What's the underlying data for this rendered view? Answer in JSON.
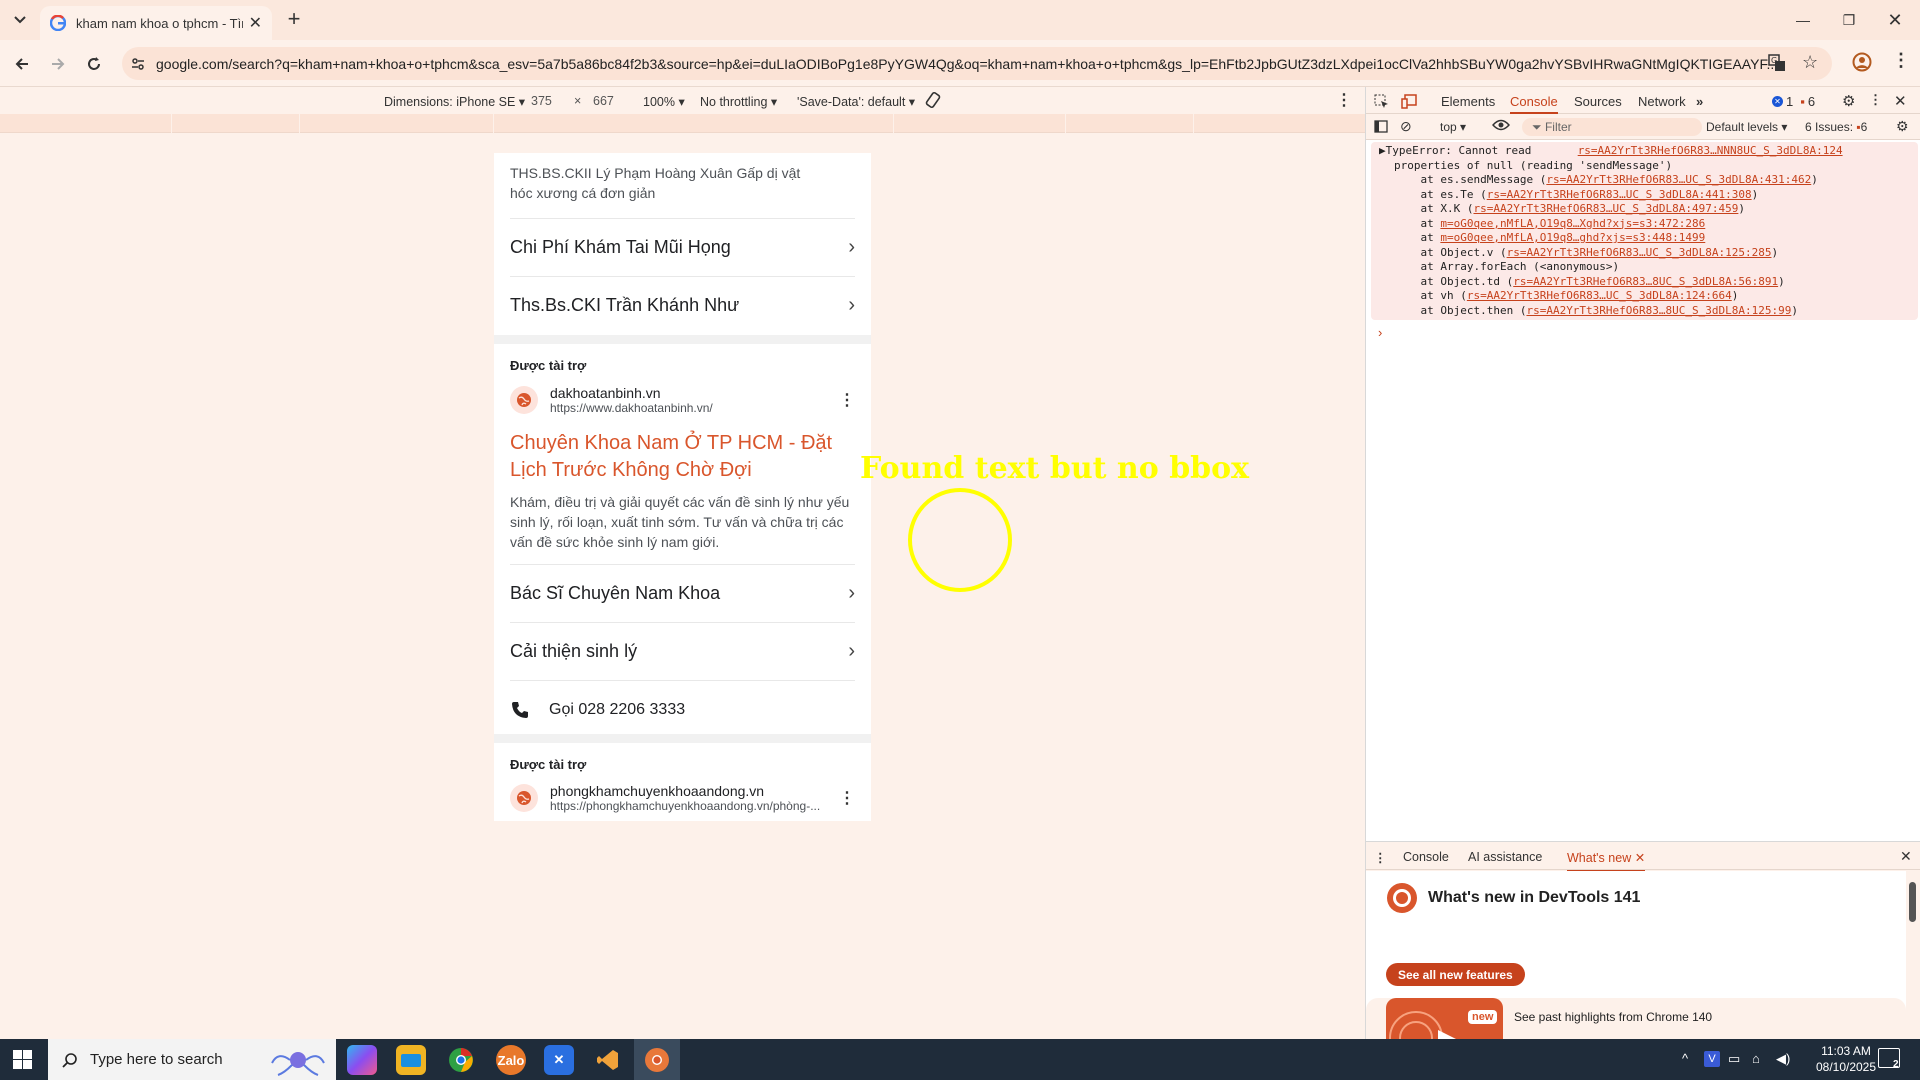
{
  "browser": {
    "tab_title": "kham nam khoa o tphcm - Tìm",
    "url": "google.com/search?q=kham+nam+khoa+o+tphcm&sca_esv=5a7b5a86bc84f2b3&source=hp&ei=duLIaODIBoPg1e8PyYGW4Qg&oq=kham+nam+khoa+o+tphcm&gs_lp=EhFtb2JpbGUtZ3dzLXdpei1ocClVa2hhbSBuYW0ga2hvYSBvIHRwaGNtMgIQKTIGEAAYF..."
  },
  "device_toolbar": {
    "dimensions": "Dimensions: iPhone SE",
    "width": "375",
    "times": "×",
    "height": "667",
    "zoom": "100%",
    "throttling": "No throttling",
    "save_data": "'Save-Data': default"
  },
  "page": {
    "top_snippet": "THS.BS.CKII Lý Phạm Hoàng Xuân Gấp dị vật hóc xương cá đơn giản",
    "links1": [
      "Chi Phí Khám Tai Mũi Họng",
      "Ths.Bs.CKI Trần Khánh Như"
    ],
    "ad1": {
      "sponsored": "Được tài trợ",
      "site_name": "dakhoatanbinh.vn",
      "site_url": "https://www.dakhoatanbinh.vn/",
      "title": "Chuyên Khoa Nam Ở TP HCM - Đặt Lịch Trước Không Chờ Đợi",
      "description": "Khám, điều trị và giải quyết các vấn đề sinh lý như yếu sinh lý, rối loạn, xuất tinh sớm. Tư vấn và chữa trị các vấn đề sức khỏe sinh lý nam giới.",
      "links": [
        "Bác Sĩ Chuyên Nam Khoa",
        "Cải thiện sinh lý"
      ],
      "call": "Gọi 028 2206 3333"
    },
    "ad2": {
      "sponsored": "Được tài trợ",
      "site_name": "phongkhamchuyenkhoaandong.vn",
      "site_url": "https://phongkhamchuyenkhoaandong.vn/phòng-..."
    }
  },
  "overlay": {
    "label": "Found text but no bbox",
    "color": "#ffff00"
  },
  "devtools": {
    "tabs": [
      "Elements",
      "Console",
      "Sources",
      "Network"
    ],
    "active_tab": "Console",
    "error_count": "1",
    "warning_count": "6",
    "context": "top",
    "filter_placeholder": "Filter",
    "levels": "Default levels",
    "issues": "6 Issues:",
    "issues_count": "6",
    "console_lines": [
      {
        "text": "▶TypeError: Cannot read       ",
        "link": "rs=AA2YrTt3RHefO6R83…NNN8UC_S_3dDL8A:124"
      },
      {
        "text": "properties of null (reading 'sendMessage')",
        "link": ""
      },
      {
        "text": "    at es.sendMessage (",
        "link": "rs=AA2YrTt3RHefO6R83…UC_S_3dDL8A:431:462",
        "tail": ")"
      },
      {
        "text": "    at es.Te (",
        "link": "rs=AA2YrTt3RHefO6R83…UC_S_3dDL8A:441:308",
        "tail": ")"
      },
      {
        "text": "    at X.K (",
        "link": "rs=AA2YrTt3RHefO6R83…UC_S_3dDL8A:497:459",
        "tail": ")"
      },
      {
        "text": "    at ",
        "link": "m=oG0qee,nMfLA,O19q8…Xghd?xjs=s3:472:286",
        "tail": ""
      },
      {
        "text": "    at ",
        "link": "m=oG0qee,nMfLA,O19q8…ghd?xjs=s3:448:1499",
        "tail": ""
      },
      {
        "text": "    at Object.v (",
        "link": "rs=AA2YrTt3RHefO6R83…UC_S_3dDL8A:125:285",
        "tail": ")"
      },
      {
        "text": "    at Array.forEach (<anonymous>)",
        "link": ""
      },
      {
        "text": "    at Object.td (",
        "link": "rs=AA2YrTt3RHefO6R83…8UC_S_3dDL8A:56:891",
        "tail": ")"
      },
      {
        "text": "    at vh (",
        "link": "rs=AA2YrTt3RHefO6R83…UC_S_3dDL8A:124:664",
        "tail": ")"
      },
      {
        "text": "    at Object.then (",
        "link": "rs=AA2YrTt3RHefO6R83…8UC_S_3dDL8A:125:99",
        "tail": ")"
      }
    ],
    "drawer": {
      "tabs": [
        "Console",
        "AI assistance",
        "What's new"
      ],
      "active": "What's new",
      "heading": "What's new in DevTools 141",
      "button": "See all new features",
      "new_badge": "new",
      "highlights": "See past highlights from Chrome 140"
    }
  },
  "taskbar": {
    "search_placeholder": "Type here to search",
    "time": "11:03 AM",
    "date": "08/10/2025",
    "notifications": "2"
  },
  "colors": {
    "accent": "#c6421c",
    "ad_title": "#d9562c",
    "chrome_bg": "#fdf1ea"
  }
}
